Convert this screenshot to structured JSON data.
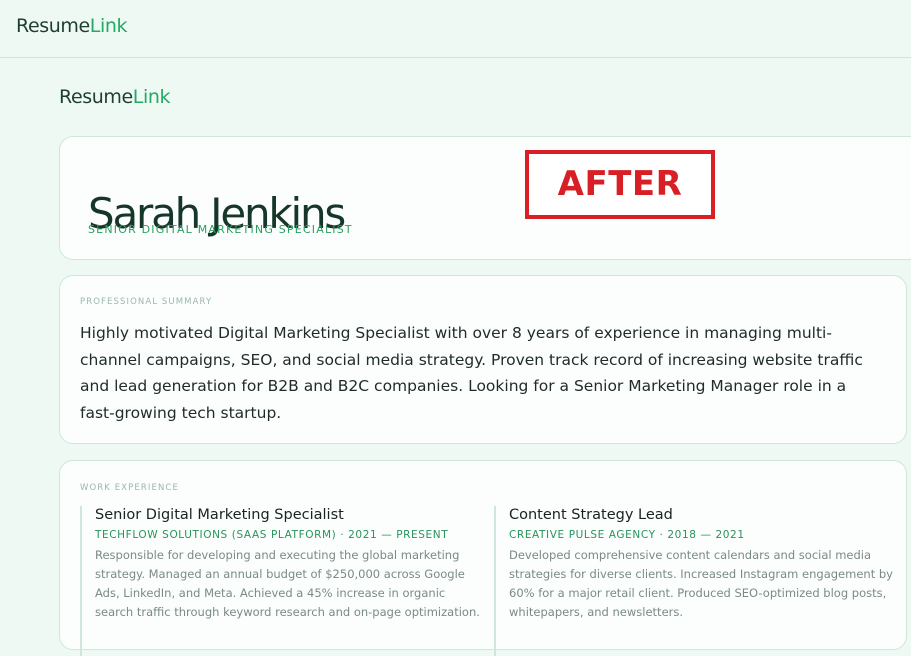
{
  "app": {
    "brand_part1": "Resume",
    "brand_part2": "Link"
  },
  "header": {
    "name": "Sarah Jenkins",
    "role": "SENIOR DIGITAL MARKETING SPECIALIST"
  },
  "overlay": {
    "label": "AFTER",
    "color": "#d81f26"
  },
  "summary": {
    "label": "PROFESSIONAL SUMMARY",
    "text": "Highly motivated Digital Marketing Specialist with over 8 years of experience in managing multi-channel campaigns, SEO, and social media strategy. Proven track record of increasing website traffic and lead generation for B2B and B2C companies. Looking for a Senior Marketing Manager role in a fast-growing tech startup."
  },
  "work": {
    "label": "WORK EXPERIENCE",
    "jobs": [
      {
        "title": "Senior Digital Marketing Specialist",
        "meta": "TECHFLOW SOLUTIONS (SAAS PLATFORM) · 2021 — PRESENT",
        "description": "Responsible for developing and executing the global marketing strategy. Managed an annual budget of $250,000 across Google Ads, LinkedIn, and Meta. Achieved a 45% increase in organic search traffic through keyword research and on-page optimization."
      },
      {
        "title": "Content Strategy Lead",
        "meta": "CREATIVE PULSE AGENCY · 2018 — 2021",
        "description": "Developed comprehensive content calendars and social media strategies for diverse clients. Increased Instagram engagement by 60% for a major retail client. Produced SEO-optimized blog posts, whitepapers, and newsletters."
      }
    ]
  },
  "colors": {
    "background": "#eef9f3",
    "accent": "#25a866",
    "card_border": "#cfe7da"
  }
}
